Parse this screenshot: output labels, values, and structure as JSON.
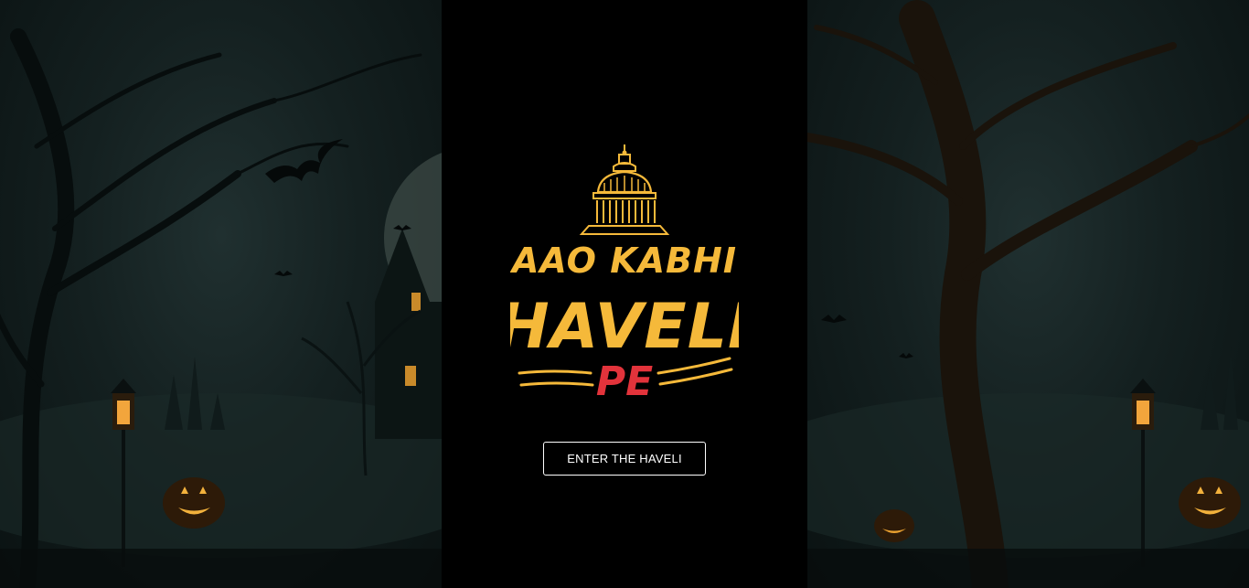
{
  "logo": {
    "line1": "AAO KABHI",
    "line2": "HAVELI",
    "line3": "PE"
  },
  "enter_button": {
    "label": "ENTER THE HAVELI"
  },
  "colors": {
    "gold": "#f5b93a",
    "red": "#e2333b",
    "button_border": "#ffffff",
    "panel_bg": "#000000"
  },
  "background": {
    "theme": "haunted-night-forest",
    "elements": [
      "moon",
      "bats",
      "haunted-house",
      "bare-trees",
      "lanterns",
      "jack-o-lanterns"
    ]
  }
}
